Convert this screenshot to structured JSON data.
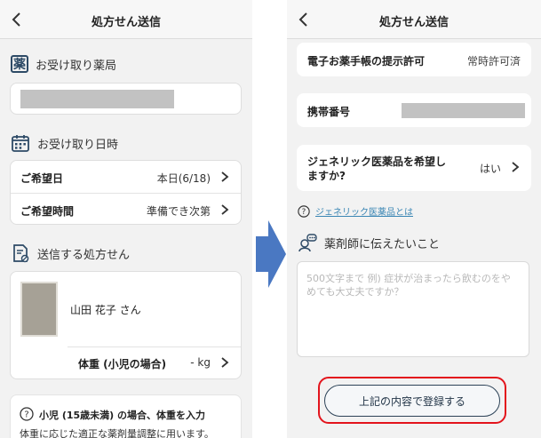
{
  "left": {
    "header_title": "処方せん送信",
    "pharmacy_section": {
      "label": "お受け取り薬局",
      "icon_glyph": "薬"
    },
    "datetime_section": {
      "label": "お受け取り日時",
      "rows": [
        {
          "label": "ご希望日",
          "value": "本日(6/18)"
        },
        {
          "label": "ご希望時間",
          "value": "準備でき次第"
        }
      ]
    },
    "prescription_section": {
      "label": "送信する処方せん",
      "patient_name": "山田 花子 さん",
      "weight_label": "体重 (小児の場合)",
      "weight_value": "- kg"
    },
    "notice": {
      "title": "小児 (15歳未満) の場合、体重を入力",
      "body": "体重に応じた適正な薬剤量調整に用います。"
    }
  },
  "right": {
    "header_title": "処方せん送信",
    "rows": [
      {
        "label": "電子お薬手帳の提示許可",
        "value": "常時許可済"
      },
      {
        "label": "携帯番号"
      },
      {
        "label": "ジェネリック医薬品を希望しますか?",
        "value": "はい"
      }
    ],
    "generic_link": "ジェネリック医薬品とは",
    "message_section_label": "薬剤師に伝えたいこと",
    "textarea_placeholder": "500文字まで 例) 症状が治まったら飲むのをやめても大丈夫ですか？",
    "submit_label": "上記の内容で登録する"
  },
  "colors": {
    "accent_blue": "#4a78c2",
    "highlight_red": "#e3141c",
    "link": "#3a86b4"
  }
}
